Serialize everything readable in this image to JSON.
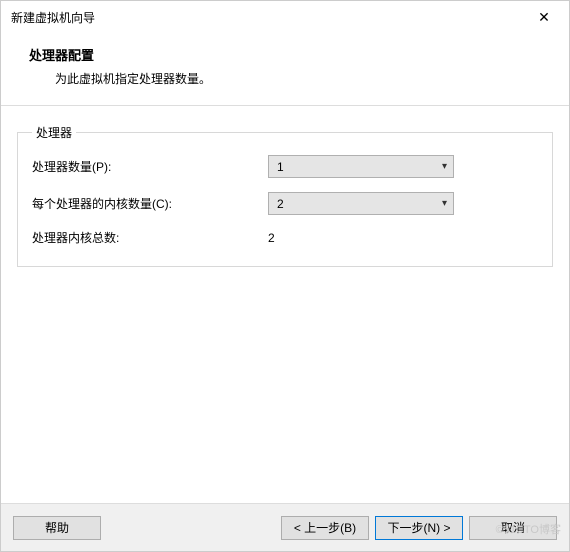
{
  "window": {
    "title": "新建虚拟机向导",
    "close_icon": "✕"
  },
  "header": {
    "title": "处理器配置",
    "subtitle": "为此虚拟机指定处理器数量。"
  },
  "group": {
    "legend": "处理器",
    "rows": {
      "proc_count": {
        "label": "处理器数量(P):",
        "value": "1"
      },
      "cores_per": {
        "label": "每个处理器的内核数量(C):",
        "value": "2"
      },
      "total": {
        "label": "处理器内核总数:",
        "value": "2"
      }
    }
  },
  "footer": {
    "help": "帮助",
    "back": "< 上一步(B)",
    "next": "下一步(N) >",
    "cancel": "取消"
  },
  "watermark": "©51CTO博客"
}
